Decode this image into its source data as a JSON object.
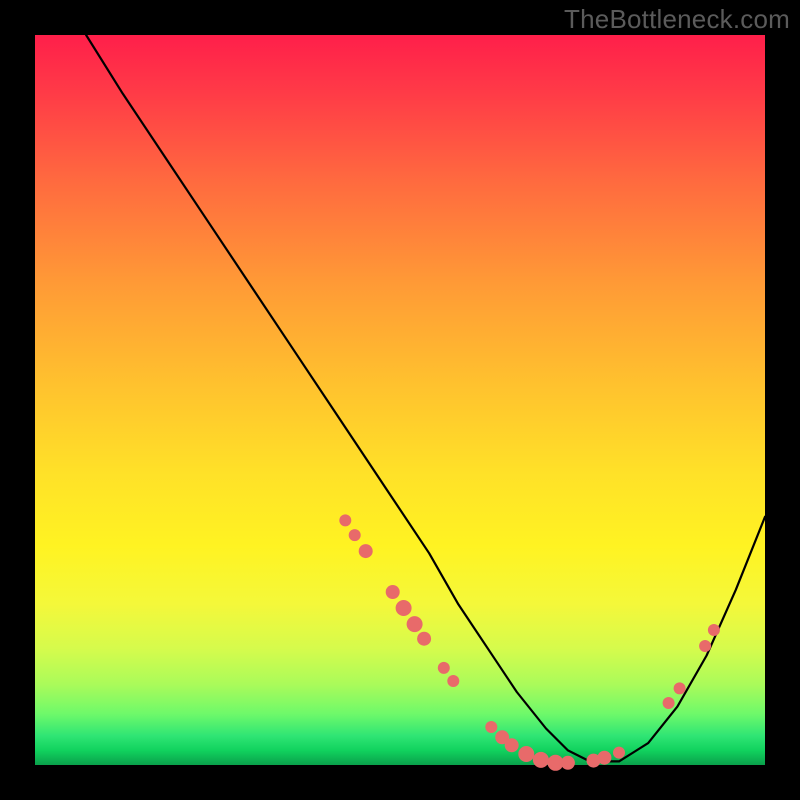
{
  "watermark": "TheBottleneck.com",
  "chart_data": {
    "type": "line",
    "title": "",
    "xlabel": "",
    "ylabel": "",
    "xlim": [
      0,
      100
    ],
    "ylim": [
      0,
      100
    ],
    "grid": false,
    "legend": false,
    "background_gradient": {
      "top": "#ff1f4a",
      "mid": "#fff322",
      "bottom": "#0aa04b"
    },
    "series": [
      {
        "name": "bottleneck-curve",
        "color": "#000000",
        "x": [
          7,
          12,
          18,
          24,
          30,
          36,
          42,
          48,
          54,
          58,
          62,
          66,
          70,
          73,
          76,
          80,
          84,
          88,
          92,
          96,
          100
        ],
        "y": [
          100,
          92,
          83,
          74,
          65,
          56,
          47,
          38,
          29,
          22,
          16,
          10,
          5,
          2,
          0.5,
          0.5,
          3,
          8,
          15,
          24,
          34
        ]
      }
    ],
    "markers": {
      "name": "highlighted-points",
      "color": "#e86a6a",
      "points": [
        {
          "x": 42.5,
          "y": 33.5,
          "r": 6
        },
        {
          "x": 43.8,
          "y": 31.5,
          "r": 6
        },
        {
          "x": 45.3,
          "y": 29.3,
          "r": 7
        },
        {
          "x": 49.0,
          "y": 23.7,
          "r": 7
        },
        {
          "x": 50.5,
          "y": 21.5,
          "r": 8
        },
        {
          "x": 52.0,
          "y": 19.3,
          "r": 8
        },
        {
          "x": 53.3,
          "y": 17.3,
          "r": 7
        },
        {
          "x": 56.0,
          "y": 13.3,
          "r": 6
        },
        {
          "x": 57.3,
          "y": 11.5,
          "r": 6
        },
        {
          "x": 62.5,
          "y": 5.2,
          "r": 6
        },
        {
          "x": 64.0,
          "y": 3.8,
          "r": 7
        },
        {
          "x": 65.3,
          "y": 2.7,
          "r": 7
        },
        {
          "x": 67.3,
          "y": 1.5,
          "r": 8
        },
        {
          "x": 69.3,
          "y": 0.7,
          "r": 8
        },
        {
          "x": 71.3,
          "y": 0.3,
          "r": 8
        },
        {
          "x": 73.0,
          "y": 0.3,
          "r": 7
        },
        {
          "x": 76.5,
          "y": 0.6,
          "r": 7
        },
        {
          "x": 78.0,
          "y": 1.0,
          "r": 7
        },
        {
          "x": 80.0,
          "y": 1.7,
          "r": 6
        },
        {
          "x": 86.8,
          "y": 8.5,
          "r": 6
        },
        {
          "x": 88.3,
          "y": 10.5,
          "r": 6
        },
        {
          "x": 91.8,
          "y": 16.3,
          "r": 6
        },
        {
          "x": 93.0,
          "y": 18.5,
          "r": 6
        }
      ]
    }
  }
}
